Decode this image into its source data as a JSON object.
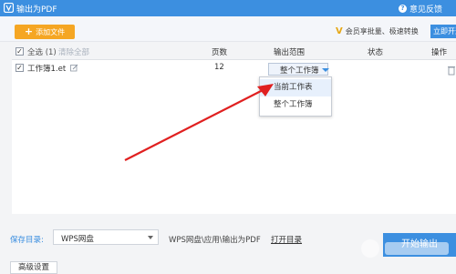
{
  "window": {
    "title": "输出为PDF",
    "feedback": "意见反馈"
  },
  "toolbar": {
    "add_file": "添加文件",
    "promo": "会员享批量、极速转换",
    "upgrade": "立即开通"
  },
  "table": {
    "headers": {
      "select_all": "全选 (1)",
      "clear_all": "清除全部",
      "pages": "页数",
      "range": "输出范围",
      "status": "状态",
      "actions": "操作"
    },
    "rows": [
      {
        "name": "工作簿1.et",
        "pages": "12",
        "range": "整个工作簿",
        "checked": true
      }
    ]
  },
  "dropdown": {
    "options": [
      "当前工作表",
      "整个工作簿"
    ],
    "hover_index": 0
  },
  "footer": {
    "save_label": "保存目录:",
    "save_value": "WPS网盘",
    "save_path": "WPS网盘\\应用\\输出为PDF",
    "open_dir": "打开目录",
    "advanced": "高级设置",
    "export": "开始输出"
  },
  "colors": {
    "accent": "#3c8fe0",
    "button": "#f5a623",
    "arrow": "#e02020"
  },
  "icons": [
    "wps-logo-icon",
    "feedback-icon",
    "plus-icon",
    "vip-icon",
    "edit-icon",
    "dropdown-caret-icon",
    "trash-icon",
    "red-arrow-annotation"
  ]
}
